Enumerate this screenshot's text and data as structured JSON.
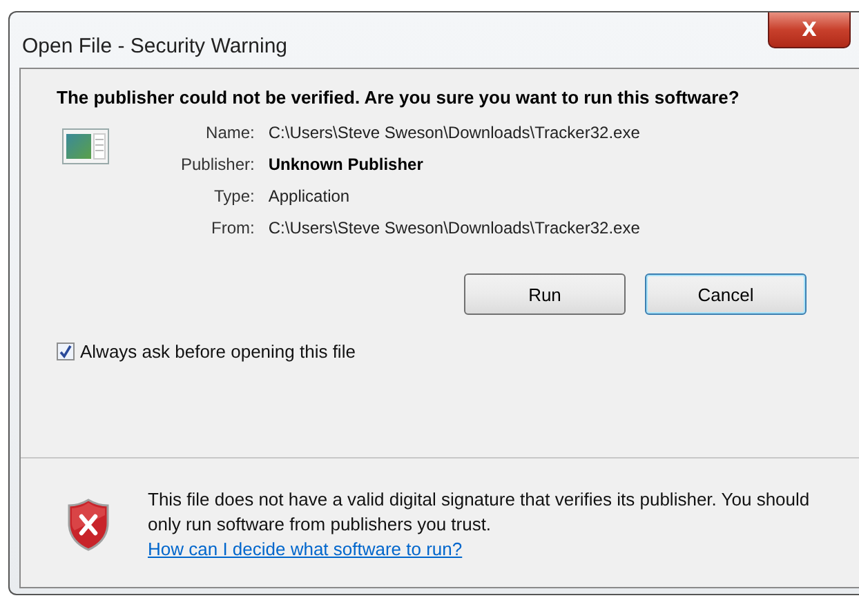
{
  "window": {
    "title": "Open File - Security Warning",
    "close": "X"
  },
  "heading": "The publisher could not be verified.  Are you sure you want to run this software?",
  "details": [
    {
      "label": "Name:",
      "value": "C:\\Users\\Steve Sweson\\Downloads\\Tracker32.exe",
      "bold": false
    },
    {
      "label": "Publisher:",
      "value": "Unknown Publisher",
      "bold": true
    },
    {
      "label": "Type:",
      "value": "Application",
      "bold": false
    },
    {
      "label": "From:",
      "value": "C:\\Users\\Steve Sweson\\Downloads\\Tracker32.exe",
      "bold": false
    }
  ],
  "buttons": [
    {
      "label": "Run",
      "focused": false
    },
    {
      "label": "Cancel",
      "focused": true
    }
  ],
  "checkbox": {
    "label": "Always ask before opening this file",
    "checked": true
  },
  "warning": {
    "text": "This file does not have a valid digital signature that verifies its publisher. You should only run software from publishers you trust.",
    "link": "How can I decide what software to run?"
  }
}
